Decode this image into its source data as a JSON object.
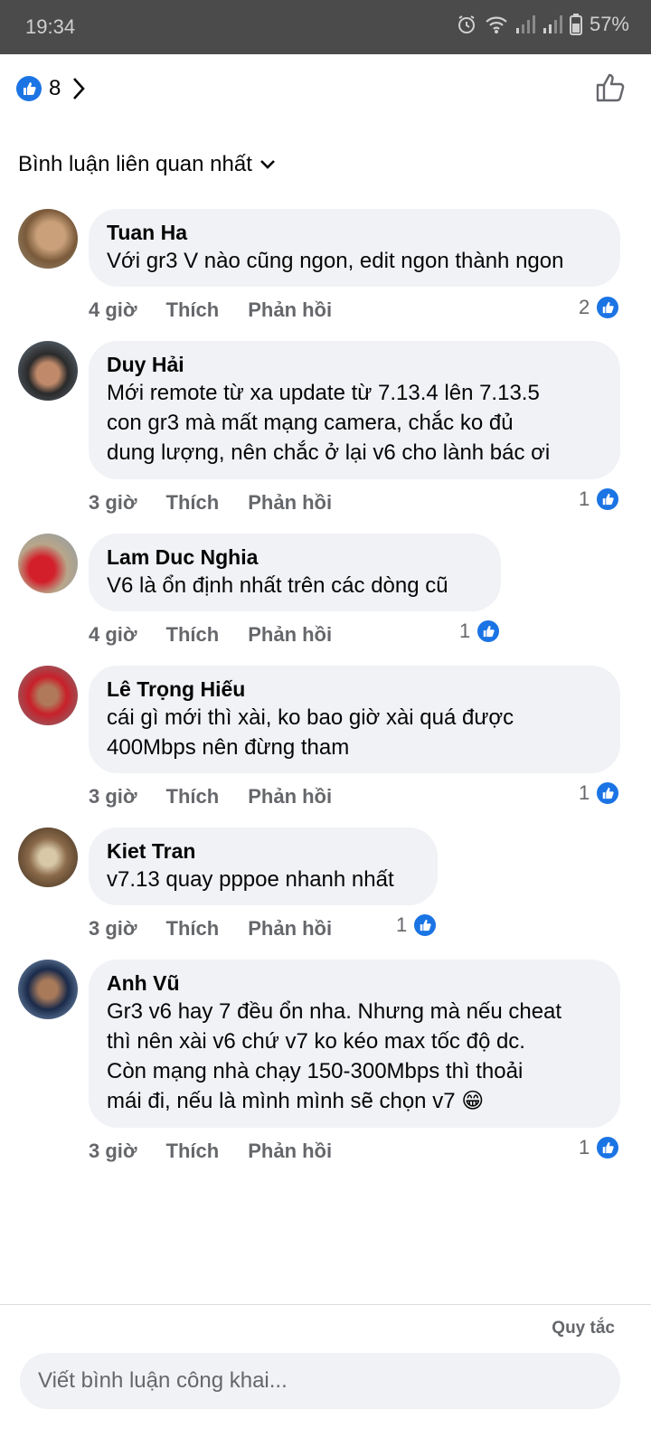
{
  "status_bar": {
    "time": "19:34",
    "battery": "57%"
  },
  "header": {
    "like_count": "8"
  },
  "sort_label": "Bình luận liên quan nhất",
  "comments": [
    {
      "author": "Tuan Ha",
      "lines": [
        "Với gr3 V nào cũng ngon, edit ngon thành ngon"
      ],
      "time": "4 giờ",
      "like": "Thích",
      "reply": "Phản hồi",
      "reactions": "2"
    },
    {
      "author": "Duy Hải",
      "lines": [
        "Mới remote từ xa update từ 7.13.4 lên 7.13.5",
        "con gr3 mà mất mạng camera, chắc ko đủ",
        "dung lượng, nên chắc ở lại v6 cho lành bác ơi"
      ],
      "time": "3 giờ",
      "like": "Thích",
      "reply": "Phản hồi",
      "reactions": "1"
    },
    {
      "author": "Lam Duc Nghia",
      "lines": [
        "V6 là ổn định nhất trên các dòng cũ"
      ],
      "time": "4 giờ",
      "like": "Thích",
      "reply": "Phản hồi",
      "reactions": "1"
    },
    {
      "author": "Lê Trọng Hiếu",
      "lines": [
        "cái gì mới thì xài, ko bao giờ xài quá được",
        "400Mbps nên đừng tham"
      ],
      "time": "3 giờ",
      "like": "Thích",
      "reply": "Phản hồi",
      "reactions": "1"
    },
    {
      "author": "Kiet Tran",
      "lines": [
        "v7.13 quay pppoe nhanh nhất"
      ],
      "time": "3 giờ",
      "like": "Thích",
      "reply": "Phản hồi",
      "reactions": "1"
    },
    {
      "author": "Anh Vũ",
      "lines": [
        "Gr3 v6 hay 7 đều ổn nha. Nhưng mà nếu cheat",
        "thì nên xài v6 chứ v7 ko kéo max tốc độ dc.",
        "Còn mạng nhà chạy 150-300Mbps thì thoải",
        "mái đi, nếu là mình mình sẽ chọn v7 😁"
      ],
      "time": "3 giờ",
      "like": "Thích",
      "reply": "Phản hồi",
      "reactions": "1"
    }
  ],
  "footer": {
    "rules": "Quy tắc",
    "composer_placeholder": "Viết bình luận công khai..."
  },
  "colors": {
    "accent": "#1b74e4",
    "bubble": "#f0f2f5",
    "muted": "#65676b"
  }
}
